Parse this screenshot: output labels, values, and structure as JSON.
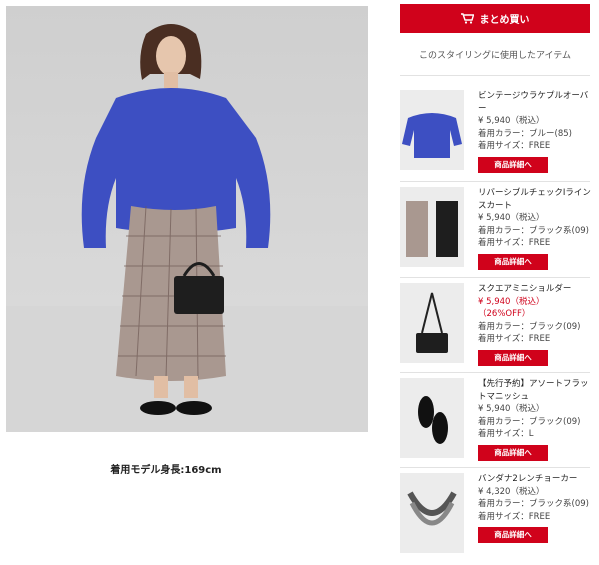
{
  "buy_all": {
    "label": "まとめ買い",
    "icon": "cart-icon"
  },
  "section_title": "このスタイリングに使用したアイテム",
  "model_height_caption": "着用モデル身長:169cm",
  "colors": {
    "accent": "#d0021b"
  },
  "items": [
    {
      "name": "ビンテージウラケプルオーバー",
      "price": "¥ 5,940（税込）",
      "discount": "",
      "color": "着用カラー：ブルー(85)",
      "size": "着用サイズ：FREE",
      "button": "商品詳細へ"
    },
    {
      "name": "リバーシブルチェックIラインスカート",
      "price": "¥ 5,940（税込）",
      "discount": "",
      "color": "着用カラー：ブラック系(09)",
      "size": "着用サイズ：FREE",
      "button": "商品詳細へ"
    },
    {
      "name": "スクエアミニショルダー",
      "price": "¥ 5,940（税込）",
      "discount": "（26%OFF）",
      "color": "着用カラー：ブラック(09)",
      "size": "着用サイズ：FREE",
      "button": "商品詳細へ"
    },
    {
      "name": "【先行予約】アソートフラットマニッシュ",
      "price": "¥ 5,940（税込）",
      "discount": "",
      "color": "着用カラー：ブラック(09)",
      "size": "着用サイズ：L",
      "button": "商品詳細へ"
    },
    {
      "name": "バンダナ2レンチョーカー",
      "price": "¥ 4,320（税込）",
      "discount": "",
      "color": "着用カラー：ブラック系(09)",
      "size": "着用サイズ：FREE",
      "button": "商品詳細へ"
    }
  ]
}
